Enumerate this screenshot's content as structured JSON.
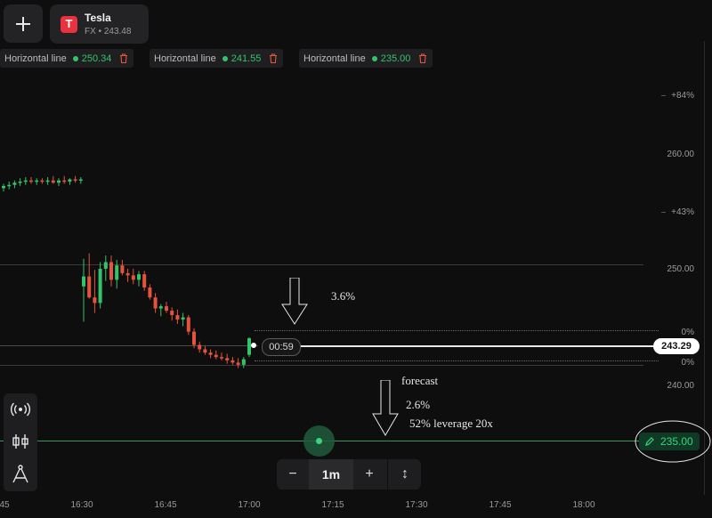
{
  "asset": {
    "name": "Tesla",
    "subtitle": "FX • 243.48"
  },
  "horizontal_lines": [
    {
      "label": "Horizontal line",
      "value": "250.34"
    },
    {
      "label": "Horizontal line",
      "value": "241.55"
    },
    {
      "label": "Horizontal line",
      "value": "235.00"
    }
  ],
  "y_axis": {
    "pct_top": "+84%",
    "p260": "260.00",
    "pct_mid": "+43%",
    "p250": "250.00",
    "pct_zero_a": "0%",
    "pct_zero_b": "0%",
    "p240": "240.00"
  },
  "x_axis": [
    "16:30",
    "16:45",
    "17:00",
    "17:15",
    "17:30",
    "17:45",
    "18:00"
  ],
  "x_axis_left_partial": "45",
  "timer": "00:59",
  "current_price": "243.29",
  "forecast_line_value": "235.00",
  "timeframe": {
    "minus": "−",
    "value": "1m",
    "plus": "+",
    "expand": "↕"
  },
  "annotations": {
    "top_pct": "3.6%",
    "forecast": "forecast",
    "low_pct": "2.6%",
    "leverage": "52% leverage 20x"
  },
  "colors": {
    "up": "#31c46a",
    "down": "#e5533d",
    "forecast_line": "#2e9b5e",
    "accent_green": "#38d37c"
  },
  "chart_data": {
    "type": "candlestick",
    "candles": [
      {
        "o": 256.9,
        "h": 257.3,
        "l": 256.6,
        "c": 257.1
      },
      {
        "o": 257.1,
        "h": 257.5,
        "l": 256.8,
        "c": 257.2
      },
      {
        "o": 257.2,
        "h": 257.6,
        "l": 256.9,
        "c": 257.4
      },
      {
        "o": 257.4,
        "h": 257.8,
        "l": 257.1,
        "c": 257.5
      },
      {
        "o": 257.5,
        "h": 257.9,
        "l": 257.2,
        "c": 257.6
      },
      {
        "o": 257.6,
        "h": 257.9,
        "l": 257.3,
        "c": 257.5
      },
      {
        "o": 257.5,
        "h": 257.8,
        "l": 257.2,
        "c": 257.6
      },
      {
        "o": 257.6,
        "h": 257.8,
        "l": 257.3,
        "c": 257.5
      },
      {
        "o": 257.5,
        "h": 257.9,
        "l": 257.2,
        "c": 257.6
      },
      {
        "o": 257.6,
        "h": 258.0,
        "l": 257.3,
        "c": 257.4
      },
      {
        "o": 257.4,
        "h": 257.8,
        "l": 257.1,
        "c": 257.6
      },
      {
        "o": 257.6,
        "h": 258.0,
        "l": 257.3,
        "c": 257.5
      },
      {
        "o": 257.5,
        "h": 257.8,
        "l": 257.2,
        "c": 257.7
      },
      {
        "o": 257.7,
        "h": 258.0,
        "l": 257.4,
        "c": 257.6
      },
      {
        "o": 257.6,
        "h": 257.9,
        "l": 257.3,
        "c": 257.7
      },
      {
        "o": 248.0,
        "h": 250.5,
        "l": 244.8,
        "c": 248.9
      },
      {
        "o": 248.9,
        "h": 251.0,
        "l": 246.9,
        "c": 247.0
      },
      {
        "o": 247.0,
        "h": 249.5,
        "l": 245.6,
        "c": 246.5
      },
      {
        "o": 246.5,
        "h": 250.2,
        "l": 246.0,
        "c": 249.6
      },
      {
        "o": 249.6,
        "h": 250.8,
        "l": 248.5,
        "c": 250.2
      },
      {
        "o": 250.2,
        "h": 250.8,
        "l": 248.0,
        "c": 248.6
      },
      {
        "o": 248.6,
        "h": 250.4,
        "l": 247.8,
        "c": 249.9
      },
      {
        "o": 249.9,
        "h": 250.4,
        "l": 249.0,
        "c": 249.2
      },
      {
        "o": 249.2,
        "h": 249.6,
        "l": 248.4,
        "c": 249.0
      },
      {
        "o": 249.0,
        "h": 249.6,
        "l": 248.2,
        "c": 248.6
      },
      {
        "o": 248.6,
        "h": 249.4,
        "l": 248.0,
        "c": 249.1
      },
      {
        "o": 249.1,
        "h": 249.4,
        "l": 247.6,
        "c": 247.9
      },
      {
        "o": 247.9,
        "h": 248.2,
        "l": 246.8,
        "c": 247.0
      },
      {
        "o": 247.0,
        "h": 247.4,
        "l": 245.6,
        "c": 246.0
      },
      {
        "o": 246.0,
        "h": 246.4,
        "l": 245.3,
        "c": 246.2
      },
      {
        "o": 246.2,
        "h": 246.6,
        "l": 245.6,
        "c": 245.8
      },
      {
        "o": 245.8,
        "h": 246.1,
        "l": 244.9,
        "c": 245.4
      },
      {
        "o": 245.4,
        "h": 245.9,
        "l": 244.6,
        "c": 245.0
      },
      {
        "o": 245.0,
        "h": 245.6,
        "l": 244.4,
        "c": 245.2
      },
      {
        "o": 245.2,
        "h": 245.4,
        "l": 243.6,
        "c": 243.9
      },
      {
        "o": 243.9,
        "h": 244.2,
        "l": 242.4,
        "c": 242.7
      },
      {
        "o": 242.7,
        "h": 243.0,
        "l": 242.0,
        "c": 242.3
      },
      {
        "o": 242.3,
        "h": 242.6,
        "l": 241.8,
        "c": 242.0
      },
      {
        "o": 242.0,
        "h": 242.3,
        "l": 241.5,
        "c": 241.8
      },
      {
        "o": 241.8,
        "h": 242.2,
        "l": 241.4,
        "c": 241.6
      },
      {
        "o": 241.6,
        "h": 242.0,
        "l": 241.3,
        "c": 241.5
      },
      {
        "o": 241.5,
        "h": 241.9,
        "l": 241.0,
        "c": 241.3
      },
      {
        "o": 241.3,
        "h": 241.6,
        "l": 240.9,
        "c": 241.1
      },
      {
        "o": 241.1,
        "h": 241.5,
        "l": 240.6,
        "c": 240.9
      },
      {
        "o": 240.9,
        "h": 241.6,
        "l": 240.6,
        "c": 241.4
      },
      {
        "o": 241.8,
        "h": 243.4,
        "l": 241.6,
        "c": 243.3
      }
    ],
    "horizontal_levels": [
      250.34,
      241.55,
      235.0
    ],
    "current_price": 243.29,
    "ylim": [
      231,
      268
    ]
  }
}
